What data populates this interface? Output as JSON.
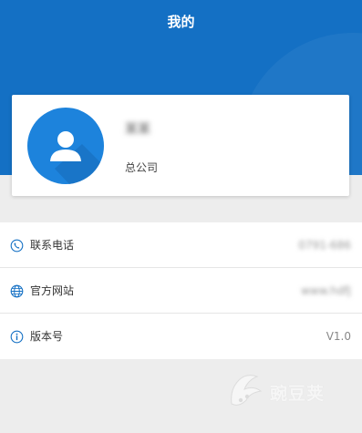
{
  "header": {
    "title": "我的",
    "color": "#1470c4"
  },
  "profile": {
    "name": "某某",
    "organization": "总公司",
    "avatar_icon": "user-avatar-icon"
  },
  "info_rows": [
    {
      "icon": "phone-icon",
      "label": "联系电话",
      "value": "0791-686"
    },
    {
      "icon": "globe-icon",
      "label": "官方网站",
      "value": "www.hdfj"
    },
    {
      "icon": "info-icon",
      "label": "版本号",
      "value": "V1.0"
    }
  ],
  "watermark": {
    "text": "豌豆荚"
  }
}
